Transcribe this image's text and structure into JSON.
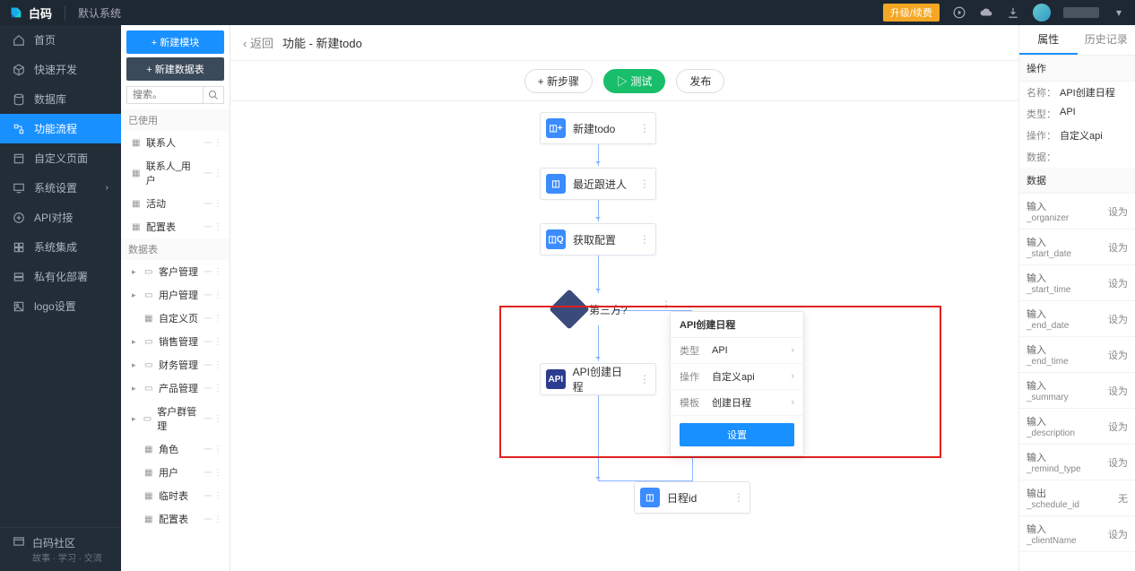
{
  "topbar": {
    "brand": "白码",
    "system": "默认系统",
    "upgrade": "升级/续费"
  },
  "nav": {
    "items": [
      {
        "label": "首页"
      },
      {
        "label": "快速开发"
      },
      {
        "label": "数据库"
      },
      {
        "label": "功能流程"
      },
      {
        "label": "自定义页面"
      },
      {
        "label": "系统设置"
      },
      {
        "label": "API对接"
      },
      {
        "label": "系统集成"
      },
      {
        "label": "私有化部署"
      },
      {
        "label": "logo设置"
      }
    ],
    "community": {
      "title": "白码社区",
      "sub": "故事 · 学习 · 交流"
    }
  },
  "secondary": {
    "btn_module": "+  新建模块",
    "btn_table": "+  新建数据表",
    "search_ph": "搜索。",
    "group_used": "已使用",
    "used_items": [
      "联系人",
      "联系人_用户",
      "活动",
      "配置表"
    ],
    "group_tables": "数据表",
    "tree": [
      {
        "label": "客户管理",
        "folder": true
      },
      {
        "label": "用户管理",
        "folder": true
      },
      {
        "label": "自定义页",
        "folder": false
      },
      {
        "label": "销售管理",
        "folder": true
      },
      {
        "label": "财务管理",
        "folder": true
      },
      {
        "label": "产品管理",
        "folder": true
      },
      {
        "label": "客户群管理",
        "folder": true
      },
      {
        "label": "角色",
        "folder": false
      },
      {
        "label": "用户",
        "folder": false
      },
      {
        "label": "临时表",
        "folder": false
      },
      {
        "label": "配置表",
        "folder": false
      }
    ]
  },
  "crumb": {
    "back": "返回",
    "path": "功能 - 新建todo"
  },
  "toolbar": {
    "step": "+ 新步骤",
    "test": "测试",
    "publish": "发布"
  },
  "nodes": {
    "n1": "新建todo",
    "n2": "最近跟进人",
    "n3": "获取配置",
    "cond": "第三方?",
    "n4": "API创建日程",
    "n5": "日程id"
  },
  "pop": {
    "title": "API创建日程",
    "rows": [
      {
        "lbl": "类型",
        "val": "API"
      },
      {
        "lbl": "操作",
        "val": "自定义api"
      },
      {
        "lbl": "模板",
        "val": "创建日程"
      }
    ],
    "btn": "设置"
  },
  "rp": {
    "tab1": "属性",
    "tab2": "历史记录",
    "sec_op": "操作",
    "kvs": [
      {
        "k": "名称：",
        "v": "API创建日程"
      },
      {
        "k": "类型：",
        "v": "API"
      },
      {
        "k": "操作：",
        "v": "自定义api"
      },
      {
        "k": "数据：",
        "v": ""
      }
    ],
    "sec_data": "数据",
    "data": [
      {
        "t1": "输入",
        "t2": "_organizer",
        "act": "设为"
      },
      {
        "t1": "输入",
        "t2": "_start_date",
        "act": "设为"
      },
      {
        "t1": "输入",
        "t2": "_start_time",
        "act": "设为"
      },
      {
        "t1": "输入",
        "t2": "_end_date",
        "act": "设为"
      },
      {
        "t1": "输入",
        "t2": "_end_time",
        "act": "设为"
      },
      {
        "t1": "输入",
        "t2": "_summary",
        "act": "设为"
      },
      {
        "t1": "输入",
        "t2": "_description",
        "act": "设为"
      },
      {
        "t1": "输入",
        "t2": "_remind_type",
        "act": "设为"
      },
      {
        "t1": "输出",
        "t2": "_schedule_id",
        "act": "无"
      },
      {
        "t1": "输入",
        "t2": "_clientName",
        "act": "设为"
      }
    ]
  }
}
